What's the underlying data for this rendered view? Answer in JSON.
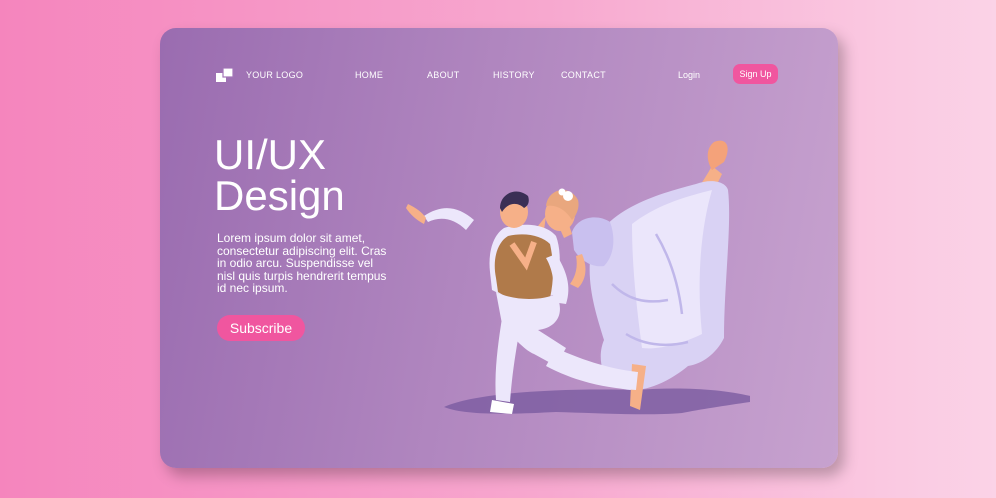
{
  "header": {
    "logo_text": "YOUR LOGO",
    "logo_icon": "stacked-squares-icon",
    "nav": [
      "HOME",
      "ABOUT",
      "HISTORY",
      "CONTACT"
    ],
    "login": "Login",
    "signup": "Sign Up"
  },
  "hero": {
    "title_line1": "UI/UX",
    "title_line2": "Design",
    "description": "Lorem ipsum dolor sit amet, consectetur adipiscing elit. Cras in odio arcu. Suspendisse vel nisl quis turpis hendrerit tempus id nec ipsum.",
    "subscribe": "Subscribe",
    "illustration": "ballet-dancers-illustration"
  },
  "colors": {
    "page_bg_left": "#f585bd",
    "page_bg_right": "#fbd3e7",
    "card_left": "#9a6cb0",
    "card_right": "#c7a2cf",
    "accent": "#f0569f",
    "text": "#ffffff"
  }
}
